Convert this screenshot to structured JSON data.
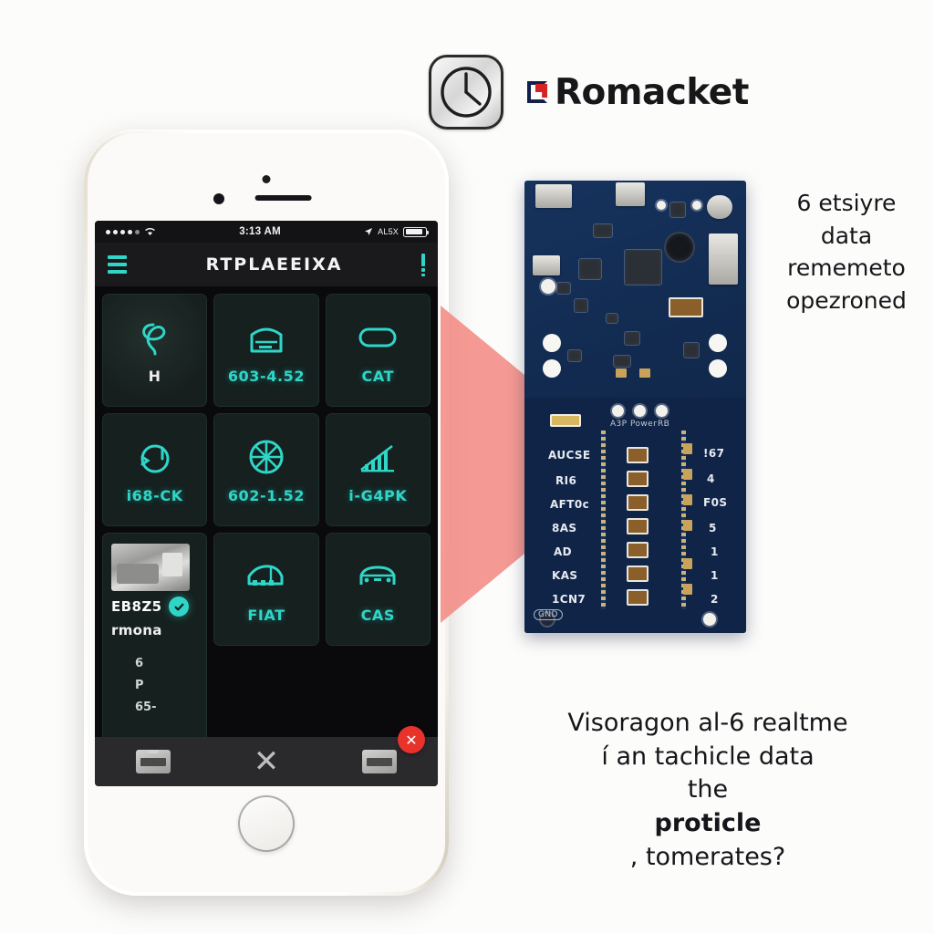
{
  "brand": {
    "name": "Romacket",
    "clock_icon": "clock-icon",
    "mark_icon": "romacket-logo-mark"
  },
  "phone": {
    "status_bar": {
      "signal_dots": "signal-dots",
      "wifi": "wifi-icon",
      "time": "3:13 AM",
      "location_icon": "location-arrow-icon",
      "battery_label": "AL5X",
      "battery_icon": "battery-icon"
    },
    "app_bar": {
      "menu_icon": "hamburger-menu-icon",
      "title": "RTPLAEEIXA",
      "action_icon": "more-options-icon"
    },
    "tiles": [
      {
        "label": "H",
        "icon": "knot-loop-icon",
        "label_color": "white",
        "lit": true
      },
      {
        "label": "603-4.52",
        "icon": "radio-deck-icon",
        "label_color": "teal",
        "lit": false
      },
      {
        "label": "CAT",
        "icon": "pill-oval-icon",
        "label_color": "teal",
        "lit": false
      },
      {
        "label": "i68-CK",
        "icon": "gauge-loop-icon",
        "label_color": "teal",
        "lit": false
      },
      {
        "label": "602-1.52",
        "icon": "fan-wheel-icon",
        "label_color": "teal",
        "lit": false
      },
      {
        "label": "i-G4PK",
        "icon": "bar-chart-icon",
        "label_color": "teal",
        "lit": false
      }
    ],
    "photo_tile": {
      "thumb_icon": "machinery-thumbnail",
      "title": "EB8Z5",
      "subtitle": "rmona",
      "check_icon": "check-badge-icon",
      "meta": [
        "6",
        "P",
        "65-"
      ]
    },
    "tiles_row3": [
      {
        "label": "FIAT",
        "icon": "car-side-icon",
        "label_color": "teal"
      },
      {
        "label": "CAS",
        "icon": "car-front-icon",
        "label_color": "teal"
      }
    ],
    "toolbar": {
      "left_icon": "camera-chip-icon",
      "center_icon": "close-x-icon",
      "right_icon": "board-chip-icon",
      "close_label": "✕"
    }
  },
  "pcb": {
    "silk_left": [
      "AUCSE",
      "RI6",
      "AFT0c",
      "8AS",
      "AD",
      "KAS",
      "1CN7"
    ],
    "silk_right": [
      "!67",
      "4",
      "F0S",
      "5",
      "1",
      "1",
      "2"
    ],
    "silk_top": [
      "A3P",
      "Power",
      "RB"
    ],
    "silk_corner": "GND"
  },
  "side_copy": [
    "6 etsiyre",
    "data",
    "rememeto",
    "opezroned"
  ],
  "bottom_copy": {
    "line1": "Visoragon al-6 realtme",
    "line2": "í an tachicle data",
    "line3_pre": "the ",
    "line3_bold": "proticle",
    "line3_post": ", tomerates?"
  },
  "colors": {
    "accent_teal": "#2fd6c8",
    "wedge_pink": "#f38b84",
    "close_red": "#e8322c",
    "pcb_blue": "#16335e",
    "background": "#fcfcfb"
  }
}
